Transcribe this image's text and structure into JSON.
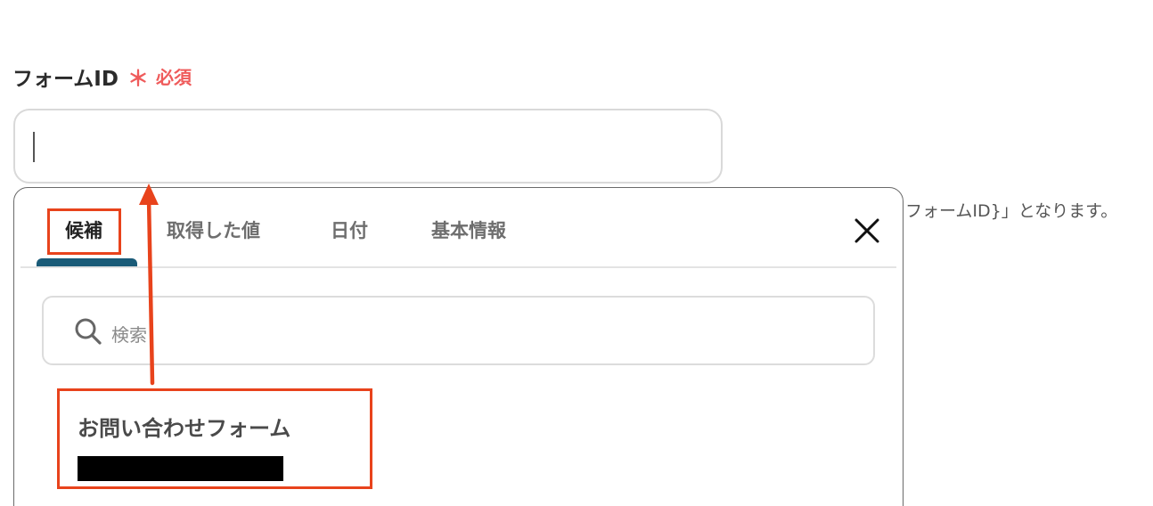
{
  "form": {
    "label": "フォームID",
    "required_mark": "＊",
    "required_text": "必須",
    "input_value": "",
    "hint": "フォームID}」となります。"
  },
  "popover": {
    "tabs": [
      {
        "label": "候補",
        "active": true
      },
      {
        "label": "取得した値",
        "active": false
      },
      {
        "label": "日付",
        "active": false
      },
      {
        "label": "基本情報",
        "active": false
      }
    ],
    "close_icon": "close-icon",
    "search": {
      "placeholder": "検索",
      "icon": "search-icon"
    },
    "candidates": [
      {
        "title": "お問い合わせフォーム",
        "id_redacted": true
      }
    ]
  },
  "colors": {
    "required": "#ef5b5b",
    "tab_indicator": "#1a5b78",
    "annotation": "#e8431c"
  }
}
